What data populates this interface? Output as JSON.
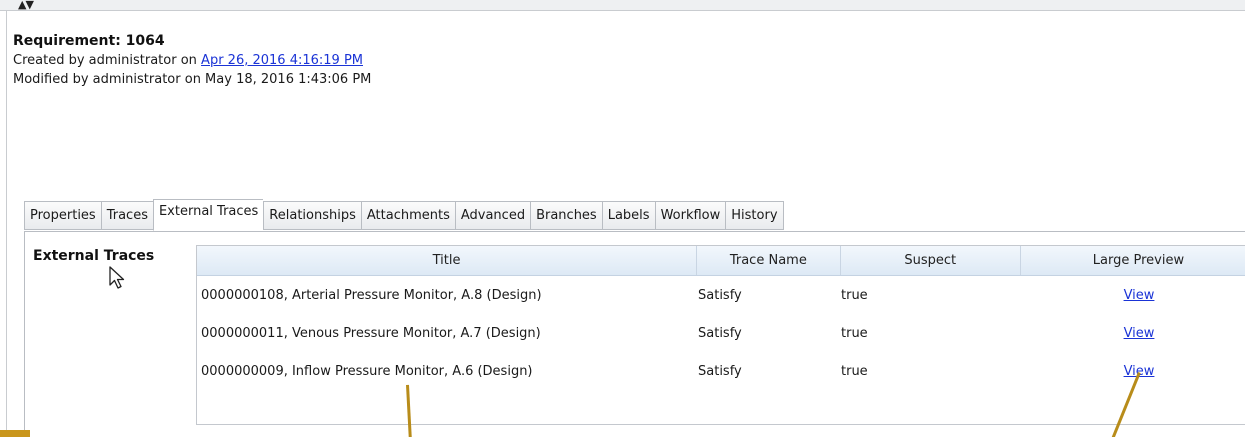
{
  "header": {
    "title": "Requirement: 1064",
    "created_prefix": "Created by administrator on ",
    "created_link": "Apr 26, 2016 4:16:19 PM",
    "modified": "Modified by administrator on May 18, 2016 1:43:06 PM"
  },
  "tabs": [
    {
      "label": "Properties"
    },
    {
      "label": "Traces"
    },
    {
      "label": "External Traces"
    },
    {
      "label": "Relationships"
    },
    {
      "label": "Attachments"
    },
    {
      "label": "Advanced"
    },
    {
      "label": "Branches"
    },
    {
      "label": "Labels"
    },
    {
      "label": "Workflow"
    },
    {
      "label": "History"
    }
  ],
  "section_label": "External Traces",
  "grid": {
    "columns": [
      "Title",
      "Trace Name",
      "Suspect",
      "Large Preview"
    ],
    "rows": [
      {
        "title": "0000000108, Arterial Pressure Monitor, A.8 (Design)",
        "trace_name": "Satisfy",
        "suspect": "true",
        "preview": "View"
      },
      {
        "title": "0000000011, Venous Pressure Monitor, A.7 (Design)",
        "trace_name": "Satisfy",
        "suspect": "true",
        "preview": "View"
      },
      {
        "title": "0000000009, Inflow Pressure Monitor, A.6 (Design)",
        "trace_name": "Satisfy",
        "suspect": "true",
        "preview": "View"
      }
    ]
  },
  "colors": {
    "link": "#1a33d6",
    "annotation": "#b88c1a",
    "header_grad_top": "#f2f7fc",
    "header_grad_bottom": "#dde9f5"
  },
  "icons": {
    "collapse": "collapse-arrows-icon",
    "cursor": "mouse-pointer-icon"
  }
}
